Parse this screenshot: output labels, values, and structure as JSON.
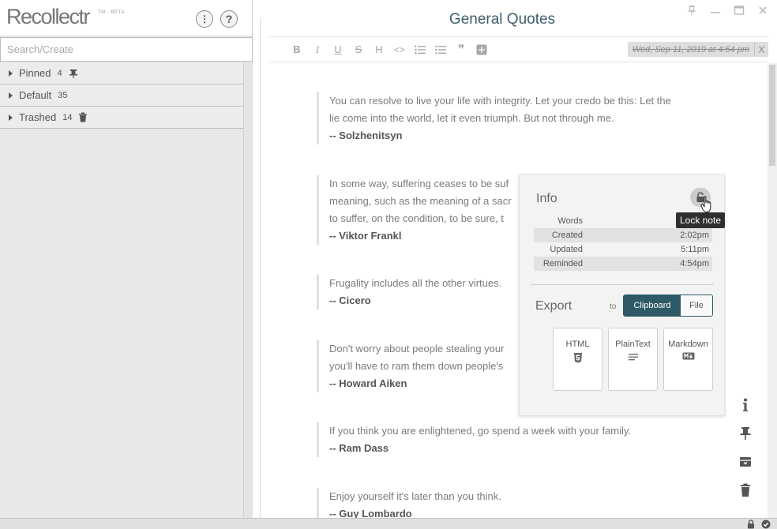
{
  "app": {
    "logo_text": "Recollectr",
    "logo_badge": "TM - BETA",
    "help_label": "?",
    "menu_label": "⋮"
  },
  "search": {
    "placeholder": "Search/Create"
  },
  "notebooks": [
    {
      "label": "Pinned",
      "count": "4",
      "icon": "pin-icon"
    },
    {
      "label": "Default",
      "count": "35",
      "icon": ""
    },
    {
      "label": "Trashed",
      "count": "14",
      "icon": "trash-icon"
    }
  ],
  "note": {
    "title": "General Quotes",
    "reminder": "Wed, Sep 11, 2019 at 4:54 pm",
    "reminder_clear": "X",
    "quotes": [
      {
        "text_lines": [
          "You can resolve to live your life with integrity. Let your credo be this: Let the",
          "lie come into the world, let it even triumph. But not through me."
        ],
        "author": "-- Solzhenitsyn"
      },
      {
        "text_lines": [
          "In some way, suffering ceases to be suf",
          "meaning, such as the meaning of a sacr",
          "to suffer, on the condition, to be sure, t"
        ],
        "author": "-- Viktor Frankl"
      },
      {
        "text_lines": [
          "Frugality includes all the other virtues."
        ],
        "author": "-- Cicero"
      },
      {
        "text_lines": [
          "Don't worry about people stealing your",
          "you'll have to ram them down people's"
        ],
        "author": "-- Howard Aiken"
      },
      {
        "text_lines": [
          "If you think you are enlightened, go spend a week with your family."
        ],
        "author": "-- Ram Dass"
      },
      {
        "text_lines": [
          "Enjoy yourself it's later than you think."
        ],
        "author": "-- Guy Lombardo"
      }
    ]
  },
  "toolbar": {
    "bold": "B",
    "italic": "I",
    "underline": "U",
    "strike": "S",
    "heading": "H",
    "code": "<>",
    "quote": "❞"
  },
  "info": {
    "heading": "Info",
    "lock_tooltip": "Lock note",
    "stats": [
      {
        "label": "Words",
        "value": ""
      },
      {
        "label": "Created",
        "value": "2:02pm"
      },
      {
        "label": "Updated",
        "value": "5:11pm"
      },
      {
        "label": "Reminded",
        "value": "4:54pm"
      }
    ],
    "export_heading": "Export",
    "export_to": "to",
    "clipboard": "Clipboard",
    "file": "File",
    "formats": [
      {
        "label": "HTML"
      },
      {
        "label": "PlainText"
      },
      {
        "label": "Markdown"
      }
    ]
  },
  "colors": {
    "accent": "#2d5a66",
    "title": "#3c5f6e"
  }
}
